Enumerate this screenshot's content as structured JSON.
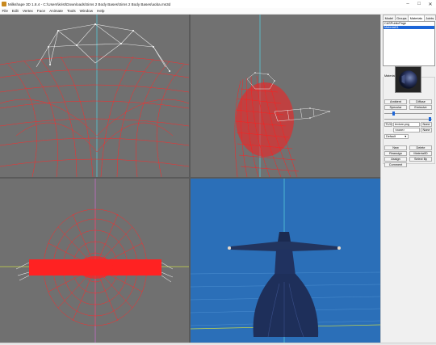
{
  "titlebar": {
    "title": "Milkshape 3D 1.8.4 - C:\\Users\\krist\\Downloads\\Sims 2 Body Bases\\Sims 2 Body Bases\\aoba.ms3d",
    "min_icon": "minimize-icon",
    "max_icon": "maximize-icon",
    "close_icon": "close-icon"
  },
  "menu": [
    "File",
    "Edit",
    "Vertex",
    "Face",
    "Animate",
    "Tools",
    "Window",
    "Help"
  ],
  "panel": {
    "tabs": [
      "Model",
      "Groups",
      "Materials",
      "Joints"
    ],
    "active_tab": "Materials",
    "materials": [
      "CASPublicPage",
      "Material01"
    ],
    "selected_material": "Material01",
    "group_label": "Material",
    "buttons": {
      "ambient": "Ambient",
      "diffuse": "Diffuse",
      "specular": "Specular",
      "emissive": "Emissive",
      "texture1": "T1/4",
      "texture1_none": "None",
      "texture2_none": "None",
      "new": "New",
      "delete": "Delete",
      "reassign": "Reassign",
      "material_id": "MaterialID",
      "assign": "Assign",
      "select_by": "Select By",
      "comment": "Comment"
    },
    "texture_file": "texture.png",
    "alpha_file": "<none>",
    "mode_select": "Default"
  },
  "colors": {
    "viewport_bg": "#5a5a5a",
    "viewport_3d_bg": "#2a6eb7",
    "wire": "#ff1a1a",
    "highlight": "#1d66d8"
  }
}
